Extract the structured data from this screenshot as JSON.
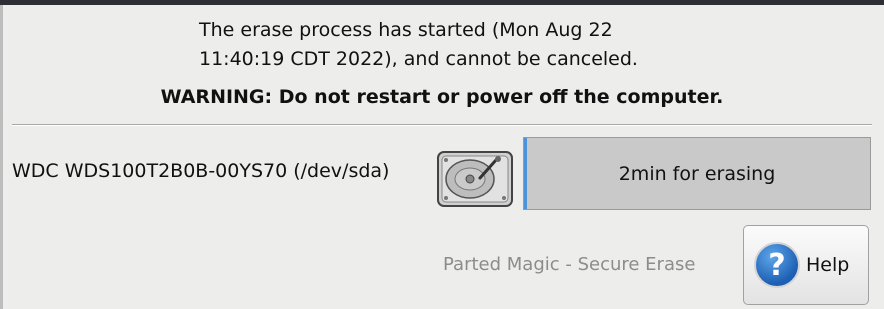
{
  "message": {
    "line1": "The erase process has started (Mon Aug 22",
    "line2": "11:40:19 CDT 2022), and cannot be canceled."
  },
  "warning": "WARNING: Do not restart or power off the computer.",
  "device": {
    "label": "WDC WDS100T2B0B-00YS70 (/dev/sda)",
    "icon": "hard-drive-icon"
  },
  "progress": {
    "text": "2min for erasing",
    "fraction": 0.01,
    "color": "#4c93d9"
  },
  "footer": "Parted Magic - Secure Erase",
  "help_button": {
    "label": "Help",
    "icon_glyph": "?",
    "icon": "help-question-icon"
  }
}
